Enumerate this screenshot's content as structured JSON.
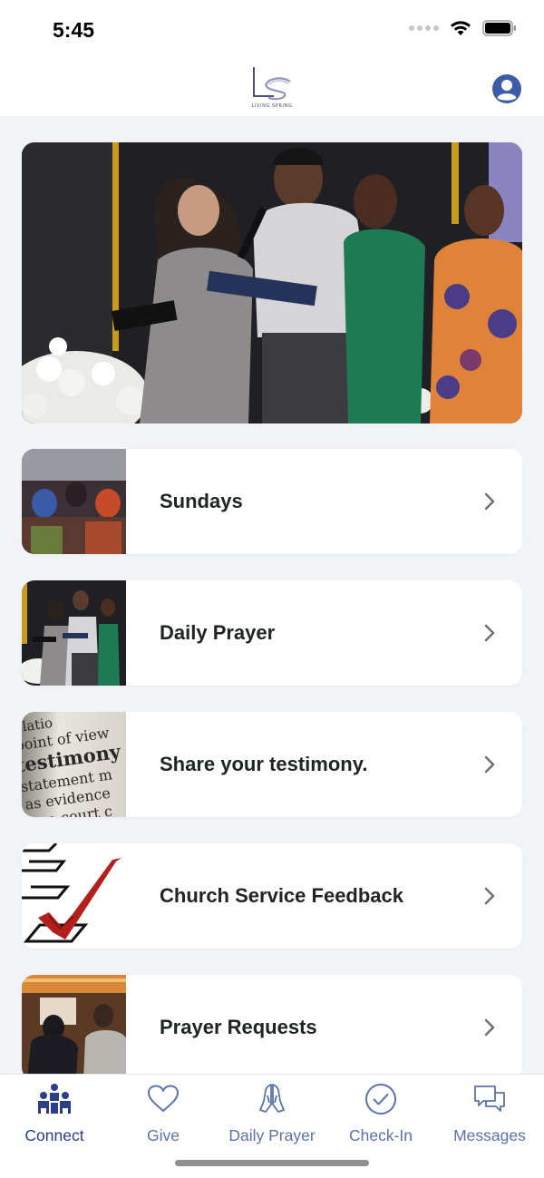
{
  "status_bar": {
    "time": "5:45"
  },
  "header": {
    "logo_text": "LIVING SPRING",
    "profile_icon": "profile-icon"
  },
  "colors": {
    "accent": "#2a3f86",
    "tab_inactive": "#5b73a8",
    "background": "#f2f3f7",
    "card": "#ffffff"
  },
  "menu": [
    {
      "label": "Sundays",
      "icon": "chevron-right-icon"
    },
    {
      "label": "Daily Prayer",
      "icon": "chevron-right-icon"
    },
    {
      "label": "Share your testimony.",
      "icon": "chevron-right-icon"
    },
    {
      "label": "Church Service Feedback",
      "icon": "chevron-right-icon"
    },
    {
      "label": "Prayer Requests",
      "icon": "chevron-right-icon"
    }
  ],
  "thumbnail_text": {
    "testimony": [
      "elatio",
      "point of view",
      "testimony",
      "statement m",
      "as evidence",
      "in a court c"
    ]
  },
  "tabs": [
    {
      "label": "Connect",
      "icon": "people-icon",
      "active": true
    },
    {
      "label": "Give",
      "icon": "heart-icon",
      "active": false
    },
    {
      "label": "Daily Prayer",
      "icon": "praying-hands-icon",
      "active": false
    },
    {
      "label": "Check-In",
      "icon": "check-circle-icon",
      "active": false
    },
    {
      "label": "Messages",
      "icon": "chat-bubbles-icon",
      "active": false
    }
  ]
}
